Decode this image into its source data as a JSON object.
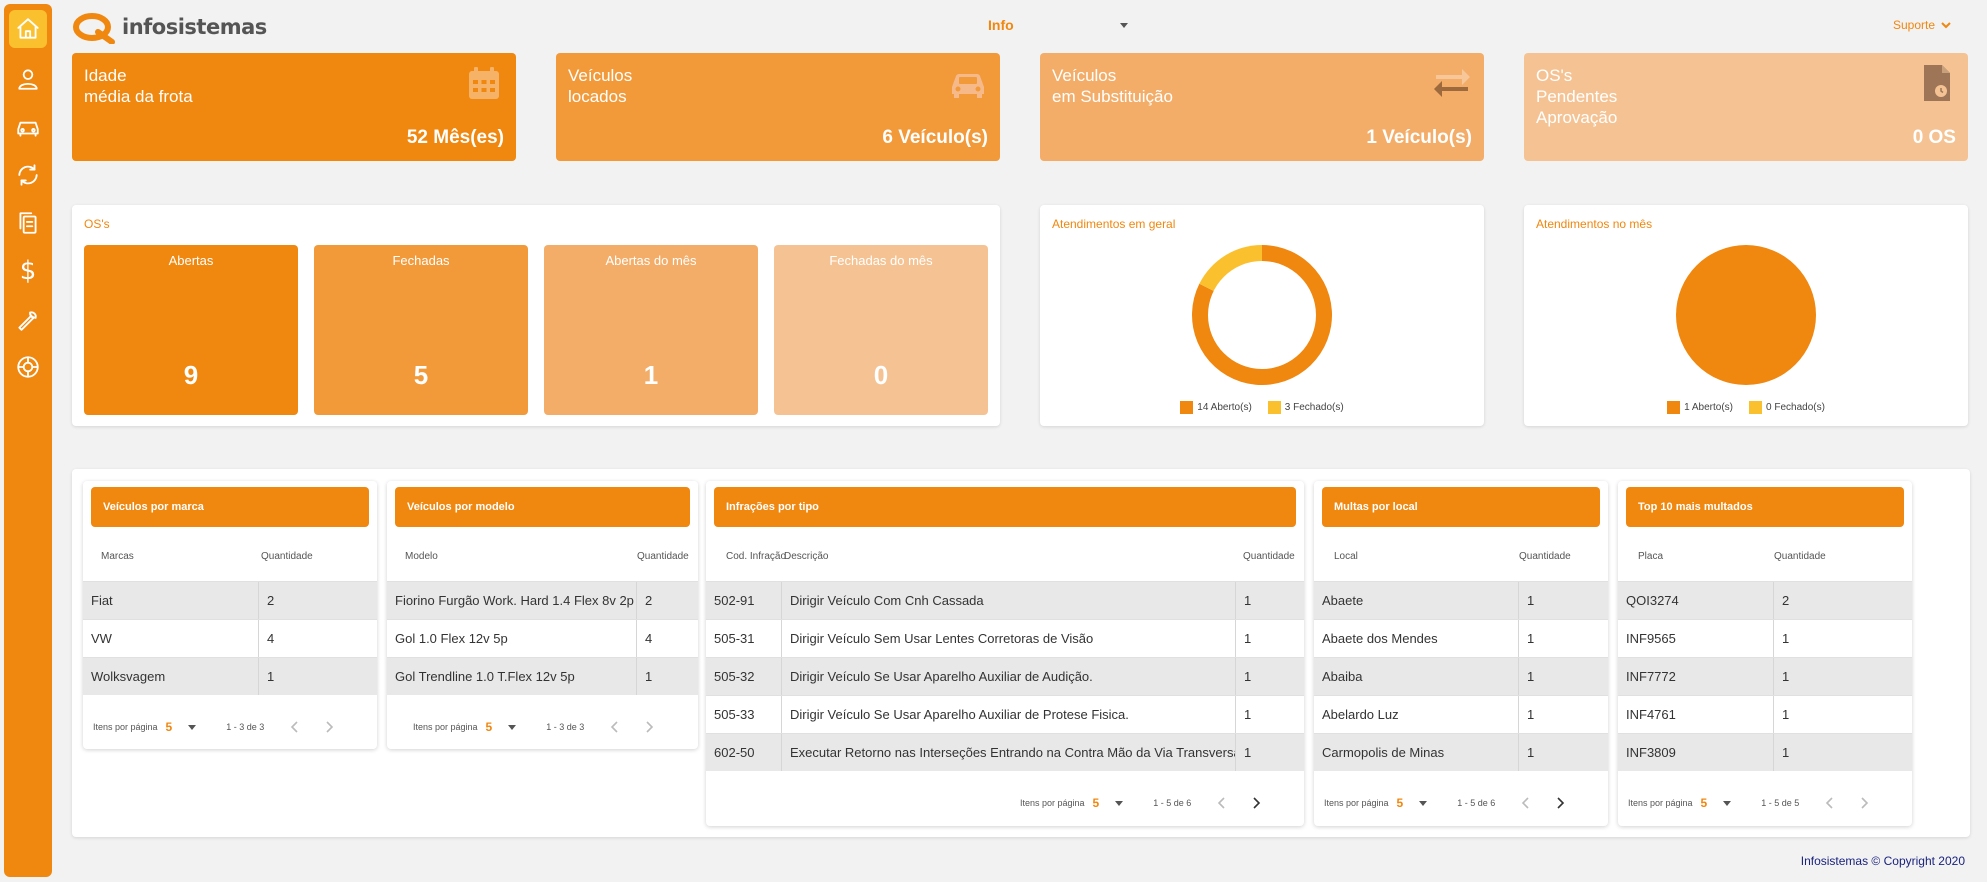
{
  "app": {
    "logo_text": "infosistemas"
  },
  "sidebar": {
    "items": [
      {
        "icon": "home-icon",
        "active": true
      },
      {
        "icon": "user-icon"
      },
      {
        "icon": "car-icon"
      },
      {
        "icon": "sync-icon"
      },
      {
        "icon": "documents-icon"
      },
      {
        "icon": "dollar-icon",
        "glyph": "$"
      },
      {
        "icon": "wrench-icon"
      },
      {
        "icon": "tire-icon"
      }
    ]
  },
  "header": {
    "info_label": "Info",
    "support_label": "Suporte"
  },
  "stats": [
    {
      "title": "Idade\nmédia da frota",
      "value": "52 Mês(es)",
      "icon": "calendar-icon",
      "color": "#f0870f"
    },
    {
      "title": "Veículos\nlocados",
      "value": "6 Veículo(s)",
      "icon": "car-icon",
      "color": "#f29a3a"
    },
    {
      "title": "Veículos\nem Substituição",
      "value": "1 Veículo(s)",
      "icon": "swap-icon",
      "color": "#f3ad68"
    },
    {
      "title": "OS's\nPendentes\nAprovação",
      "value": "0 OS",
      "icon": "pending-document-icon",
      "color": "#f5c393"
    }
  ],
  "os_panel": {
    "title": "OS's",
    "boxes": [
      {
        "label": "Abertas",
        "value": "9",
        "color": "#f0870f"
      },
      {
        "label": "Fechadas",
        "value": "5",
        "color": "#f29a3a"
      },
      {
        "label": "Abertas do mês",
        "value": "1",
        "color": "#f3ad68"
      },
      {
        "label": "Fechadas do mês",
        "value": "0",
        "color": "#f5c393"
      }
    ]
  },
  "colors": {
    "orange": "#f0870f",
    "yellow": "#fbc02d"
  },
  "chart_data": [
    {
      "type": "pie",
      "variant": "donut",
      "title": "Atendimentos em geral",
      "labels": [
        "14 Aberto(s)",
        "3 Fechado(s)"
      ],
      "values": [
        14,
        3
      ],
      "colors": [
        "#f0870f",
        "#fbc02d"
      ],
      "legend": "bottom"
    },
    {
      "type": "pie",
      "title": "Atendimentos no mês",
      "labels": [
        "1 Aberto(s)",
        "0 Fechado(s)"
      ],
      "values": [
        1,
        0
      ],
      "colors": [
        "#f0870f",
        "#fbc02d"
      ],
      "legend": "bottom"
    }
  ],
  "tables": {
    "marca": {
      "title": "Veículos por marca",
      "headers": [
        "Marcas",
        "Quantidade"
      ],
      "rows": [
        [
          "Fiat",
          "2"
        ],
        [
          "VW",
          "4"
        ],
        [
          "Wolksvagem",
          "1"
        ]
      ],
      "pager": {
        "label": "Itens por página",
        "size": "5",
        "range": "1 - 3 de 3"
      }
    },
    "modelo": {
      "title": "Veículos por modelo",
      "headers": [
        "Modelo",
        "Quantidade"
      ],
      "rows": [
        [
          "Fiorino Furgão Work. Hard 1.4 Flex 8v 2p",
          "2"
        ],
        [
          "Gol 1.0 Flex 12v 5p",
          "4"
        ],
        [
          "Gol Trendline 1.0 T.Flex 12v 5p",
          "1"
        ]
      ],
      "pager": {
        "label": "Itens por página",
        "size": "5",
        "range": "1 - 3 de 3"
      }
    },
    "infracoes": {
      "title": "Infrações por tipo",
      "headers": [
        "Cod. Infração",
        "Descrição",
        "Quantidade"
      ],
      "rows": [
        [
          "502-91",
          "Dirigir Veículo Com Cnh Cassada",
          "1"
        ],
        [
          "505-31",
          "Dirigir Veículo Sem Usar Lentes Corretoras de Visão",
          "1"
        ],
        [
          "505-32",
          "Dirigir Veículo Se Usar Aparelho Auxiliar de Audição.",
          "1"
        ],
        [
          "505-33",
          "Dirigir Veículo Se Usar Aparelho Auxiliar de Protese Fisica.",
          "1"
        ],
        [
          "602-50",
          "Executar Retorno nas Interseções Entrando na Contra Mão da Via Transversal",
          "1"
        ]
      ],
      "pager": {
        "label": "Itens por página",
        "size": "5",
        "range": "1 - 5 de 6"
      }
    },
    "multas": {
      "title": "Multas por local",
      "headers": [
        "Local",
        "Quantidade"
      ],
      "rows": [
        [
          "Abaete",
          "1"
        ],
        [
          "Abaete dos Mendes",
          "1"
        ],
        [
          "Abaiba",
          "1"
        ],
        [
          "Abelardo Luz",
          "1"
        ],
        [
          "Carmopolis de Minas",
          "1"
        ]
      ],
      "pager": {
        "label": "Itens por página",
        "size": "5",
        "range": "1 - 5 de 6"
      }
    },
    "top10": {
      "title": "Top 10 mais multados",
      "headers": [
        "Placa",
        "Quantidade"
      ],
      "rows": [
        [
          "QOI3274",
          "2"
        ],
        [
          "INF9565",
          "1"
        ],
        [
          "INF7772",
          "1"
        ],
        [
          "INF4761",
          "1"
        ],
        [
          "INF3809",
          "1"
        ]
      ],
      "pager": {
        "label": "Itens por página",
        "size": "5",
        "range": "1 - 5 de 5"
      }
    }
  },
  "footer": {
    "text": "Infosistemas © Copyright 2020"
  }
}
